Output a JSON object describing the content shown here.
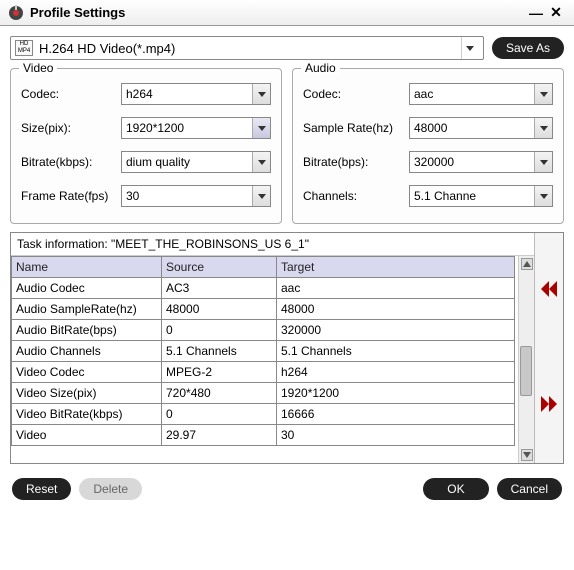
{
  "window": {
    "title": "Profile Settings"
  },
  "profile": {
    "selected": "H.264 HD Video(*.mp4)",
    "save_as": "Save As"
  },
  "video": {
    "title": "Video",
    "codec_label": "Codec:",
    "codec_value": "h264",
    "size_label": "Size(pix):",
    "size_value": "1920*1200",
    "bitrate_label": "Bitrate(kbps):",
    "bitrate_value": "dium quality",
    "framerate_label": "Frame Rate(fps)",
    "framerate_value": "30"
  },
  "audio": {
    "title": "Audio",
    "codec_label": "Codec:",
    "codec_value": "aac",
    "samplerate_label": "Sample Rate(hz)",
    "samplerate_value": "48000",
    "bitrate_label": "Bitrate(bps):",
    "bitrate_value": "320000",
    "channels_label": "Channels:",
    "channels_value": "5.1 Channe"
  },
  "task": {
    "heading": "Task information: \"MEET_THE_ROBINSONS_US 6_1\"",
    "headers": {
      "name": "Name",
      "source": "Source",
      "target": "Target"
    },
    "rows": [
      {
        "name": "Audio Codec",
        "source": "AC3",
        "target": "aac"
      },
      {
        "name": "Audio SampleRate(hz)",
        "source": "48000",
        "target": "48000"
      },
      {
        "name": "Audio BitRate(bps)",
        "source": "0",
        "target": "320000"
      },
      {
        "name": "Audio Channels",
        "source": "5.1 Channels",
        "target": "5.1 Channels"
      },
      {
        "name": "Video Codec",
        "source": "MPEG-2",
        "target": "h264"
      },
      {
        "name": "Video Size(pix)",
        "source": "720*480",
        "target": "1920*1200"
      },
      {
        "name": "Video BitRate(kbps)",
        "source": "0",
        "target": "16666"
      },
      {
        "name": "Video",
        "source": "29.97",
        "target": "30"
      }
    ]
  },
  "footer": {
    "reset": "Reset",
    "delete": "Delete",
    "ok": "OK",
    "cancel": "Cancel"
  }
}
